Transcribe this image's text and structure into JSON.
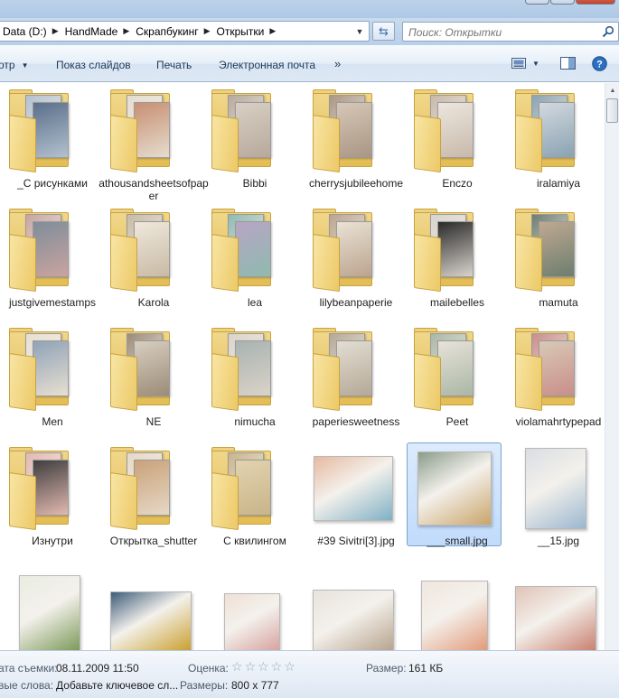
{
  "address_bar": {
    "crumbs": [
      "Data (D:)",
      "HandMade",
      "Скрапбукинг",
      "Открытки"
    ],
    "search_placeholder": "Поиск: Открытки"
  },
  "toolbar": {
    "organize_label": "отр",
    "slideshow_label": "Показ слайдов",
    "print_label": "Печать",
    "email_label": "Электронная почта",
    "more_label": "»"
  },
  "items": [
    {
      "name": "_С рисунками",
      "kind": "folder"
    },
    {
      "name": "athousandsheetsofpaper",
      "kind": "folder"
    },
    {
      "name": "Bibbi",
      "kind": "folder"
    },
    {
      "name": "cherrysjubileehome",
      "kind": "folder"
    },
    {
      "name": "Enczo",
      "kind": "folder"
    },
    {
      "name": "iralamiya",
      "kind": "folder"
    },
    {
      "name": "justgivemestamps",
      "kind": "folder"
    },
    {
      "name": "Karola",
      "kind": "folder"
    },
    {
      "name": "lea",
      "kind": "folder"
    },
    {
      "name": "lilybeanpaperie",
      "kind": "folder"
    },
    {
      "name": "mailebelles",
      "kind": "folder"
    },
    {
      "name": "mamuta",
      "kind": "folder"
    },
    {
      "name": "Men",
      "kind": "folder"
    },
    {
      "name": "NE",
      "kind": "folder"
    },
    {
      "name": "nimucha",
      "kind": "folder"
    },
    {
      "name": "paperiesweetness",
      "kind": "folder"
    },
    {
      "name": "Peet",
      "kind": "folder"
    },
    {
      "name": "violamahrtypepad",
      "kind": "folder"
    },
    {
      "name": "Изнутри",
      "kind": "folder"
    },
    {
      "name": "Открытка_shutter",
      "kind": "folder"
    },
    {
      "name": "С квилингом",
      "kind": "folder"
    },
    {
      "name": "#39 Sivitri[3].jpg",
      "kind": "image"
    },
    {
      "name": "___small.jpg",
      "kind": "image",
      "selected": true
    },
    {
      "name": "__15.jpg",
      "kind": "image"
    },
    {
      "name": "",
      "kind": "image"
    },
    {
      "name": "",
      "kind": "image"
    },
    {
      "name": "",
      "kind": "image"
    },
    {
      "name": "",
      "kind": "image"
    },
    {
      "name": "",
      "kind": "image"
    },
    {
      "name": "",
      "kind": "image"
    }
  ],
  "details": {
    "date_label": "ата съемки:",
    "date_value": "08.11.2009 11:50",
    "rating_label": "Оценка:",
    "size_label": "Размер:",
    "size_value": "161 КБ",
    "keywords_label": "вые слова:",
    "keywords_value": "Добавьте ключевое сл...",
    "dimensions_label": "Размеры:",
    "dimensions_value": "800 x 777",
    "stars": [
      "☆",
      "☆",
      "☆",
      "☆",
      "☆"
    ]
  },
  "colors": {
    "folder_yellow": "#e8c866",
    "selection": "#c1dbfc",
    "toolbar_text": "#1e395b"
  }
}
